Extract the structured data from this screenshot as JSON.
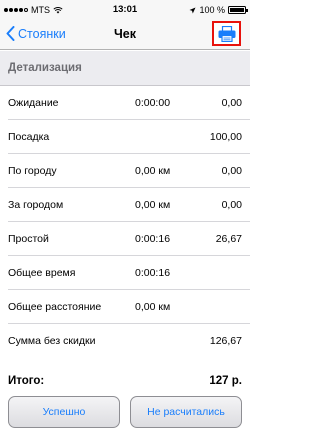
{
  "status_bar": {
    "carrier": "MTS",
    "time": "13:01",
    "battery": "100 %",
    "signal_bars": 4
  },
  "nav": {
    "back_label": "Стоянки",
    "title": "Чек",
    "print_icon": "printer-icon",
    "accent_color": "#1a7efb",
    "highlight_color": "#e8120c"
  },
  "section": {
    "title": "Детализация"
  },
  "rows": [
    {
      "label": "Ожидание",
      "mid": "0:00:00",
      "value": "0,00"
    },
    {
      "label": "Посадка",
      "mid": "",
      "value": "100,00"
    },
    {
      "label": "По городу",
      "mid": "0,00 км",
      "value": "0,00"
    },
    {
      "label": "За городом",
      "mid": "0,00 км",
      "value": "0,00"
    },
    {
      "label": "Простой",
      "mid": "0:00:16",
      "value": "26,67"
    },
    {
      "label": "Общее время",
      "mid": "0:00:16",
      "value": ""
    },
    {
      "label": "Общее расстояние",
      "mid": "0,00 км",
      "value": ""
    },
    {
      "label": "Сумма без скидки",
      "mid": "",
      "value": "126,67"
    }
  ],
  "total": {
    "label": "Итого:",
    "value": "127 р."
  },
  "buttons": {
    "success": "Успешно",
    "not_paid": "Не расчитались"
  }
}
